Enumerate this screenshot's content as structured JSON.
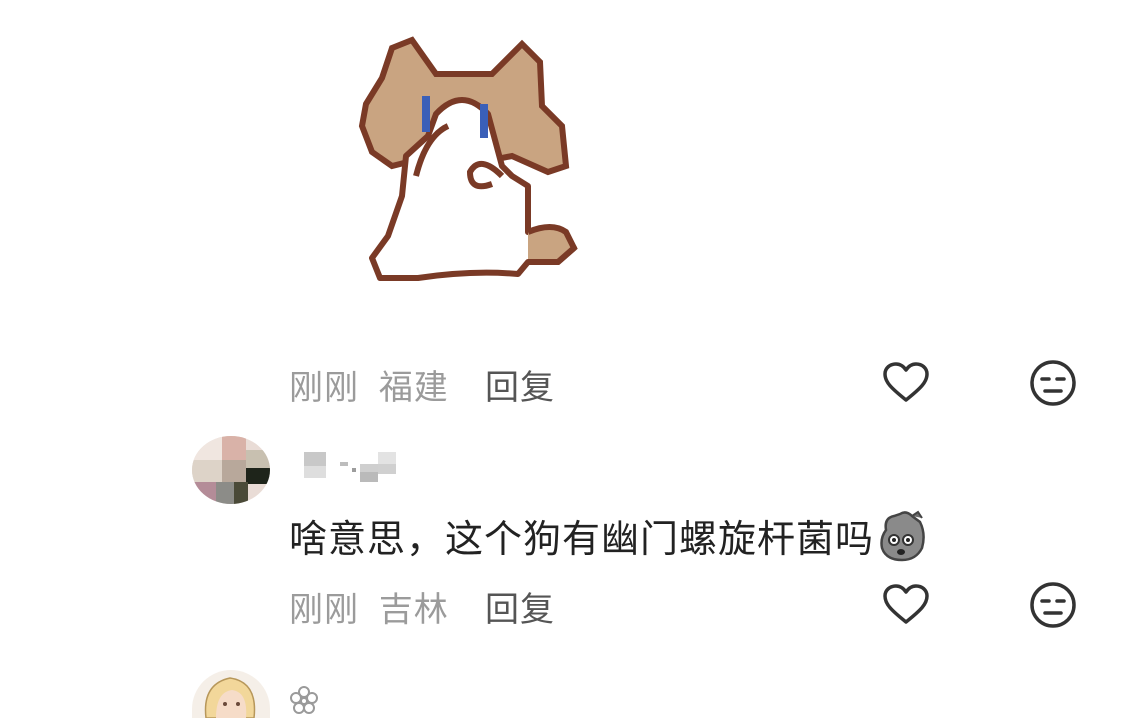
{
  "comment_prev": {
    "sticker_icon": "cat-covering-face-sticker",
    "time": "刚刚",
    "location": "福建",
    "reply_label": "回复",
    "like_icon": "heart-icon",
    "dislike_icon": "unamused-face-icon"
  },
  "comment_main": {
    "avatar_icon": "user-avatar-blurred",
    "username_icon": "pixelated-username",
    "text": "啥意思，这个狗有幽门螺旋杆菌吗",
    "emoji_icon": "shocked-dog-emoji",
    "time": "刚刚",
    "location": "吉林",
    "reply_label": "回复",
    "like_icon": "heart-icon",
    "dislike_icon": "unamused-face-icon"
  },
  "comment_next": {
    "avatar_icon": "anime-girl-avatar",
    "username_prefix_icon": "flower-icon"
  }
}
